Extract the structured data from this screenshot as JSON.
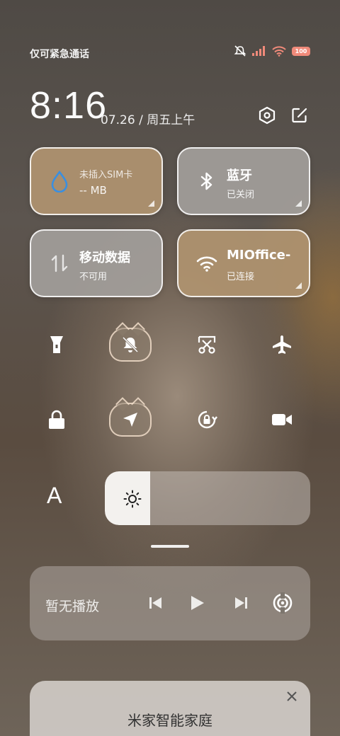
{
  "status_bar": {
    "carrier_text": "仅可紧急通话",
    "battery": "100",
    "icons": [
      "mute-bell-icon",
      "signal-icon",
      "wifi-icon",
      "battery-icon"
    ]
  },
  "header": {
    "time": "8:16",
    "date": "07.26 / 周五上午",
    "icons": [
      "settings-icon",
      "edit-icon"
    ]
  },
  "tiles": [
    {
      "id": "sim",
      "title": "未插入SIM卡",
      "sub": "-- MB",
      "icon": "water-drop-icon",
      "color": "#b09470"
    },
    {
      "id": "bluetooth",
      "title": "蓝牙",
      "sub": "已关闭",
      "icon": "bluetooth-icon",
      "color": "#a5a29e"
    },
    {
      "id": "mobile_data",
      "title": "移动数据",
      "sub": "不可用",
      "icon": "data-arrows-icon",
      "color": "#a5a29e"
    },
    {
      "id": "wifi",
      "title": "MIOffice-",
      "sub": "已连接",
      "icon": "wifi-icon",
      "color": "#b09470"
    }
  ],
  "toggles": [
    {
      "name": "flashlight",
      "icon": "flashlight-icon"
    },
    {
      "name": "silent",
      "icon": "bell-off-icon",
      "active": true
    },
    {
      "name": "screenshot",
      "icon": "scissors-icon"
    },
    {
      "name": "airplane",
      "icon": "airplane-icon"
    },
    {
      "name": "lock",
      "icon": "lock-icon"
    },
    {
      "name": "location",
      "icon": "location-arrow-icon",
      "active": true
    },
    {
      "name": "rotation_lock",
      "icon": "rotation-lock-icon"
    },
    {
      "name": "screen_record",
      "icon": "video-camera-icon"
    }
  ],
  "brightness": {
    "auto_label": "A",
    "level": 0.22
  },
  "media": {
    "status": "暂无播放"
  },
  "smart_home": {
    "title": "米家智能家庭"
  }
}
